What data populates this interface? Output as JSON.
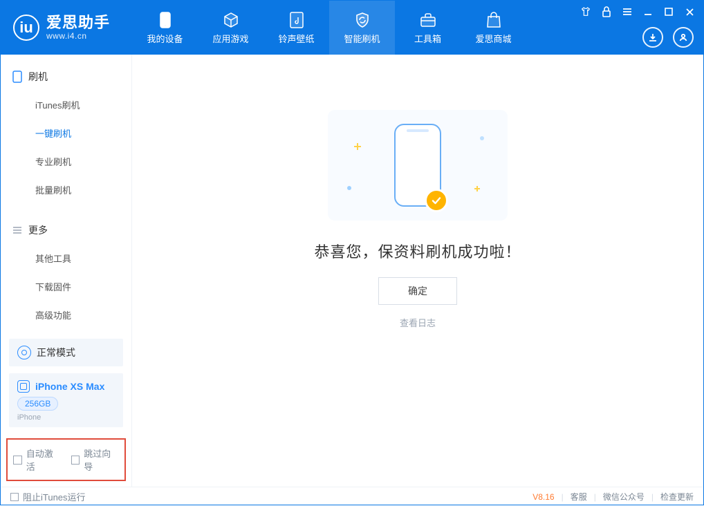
{
  "brand": {
    "title": "爱思助手",
    "subtitle": "www.i4.cn"
  },
  "topnav": [
    {
      "label": "我的设备"
    },
    {
      "label": "应用游戏"
    },
    {
      "label": "铃声壁纸"
    },
    {
      "label": "智能刷机"
    },
    {
      "label": "工具箱"
    },
    {
      "label": "爱思商城"
    }
  ],
  "sidebar": {
    "group1": {
      "title": "刷机",
      "items": [
        {
          "label": "iTunes刷机"
        },
        {
          "label": "一键刷机"
        },
        {
          "label": "专业刷机"
        },
        {
          "label": "批量刷机"
        }
      ]
    },
    "group2": {
      "title": "更多",
      "items": [
        {
          "label": "其他工具"
        },
        {
          "label": "下载固件"
        },
        {
          "label": "高级功能"
        }
      ]
    },
    "mode": "正常模式",
    "device": {
      "name": "iPhone XS Max",
      "capacity": "256GB",
      "type": "iPhone"
    },
    "options": {
      "autoActivate": "自动激活",
      "skipGuide": "跳过向导"
    }
  },
  "main": {
    "heroMsg": "恭喜您，保资料刷机成功啦！",
    "confirm": "确定",
    "viewLog": "查看日志"
  },
  "status": {
    "blockItunes": "阻止iTunes运行",
    "version": "V8.16",
    "links": [
      "客服",
      "微信公众号",
      "检查更新"
    ]
  }
}
